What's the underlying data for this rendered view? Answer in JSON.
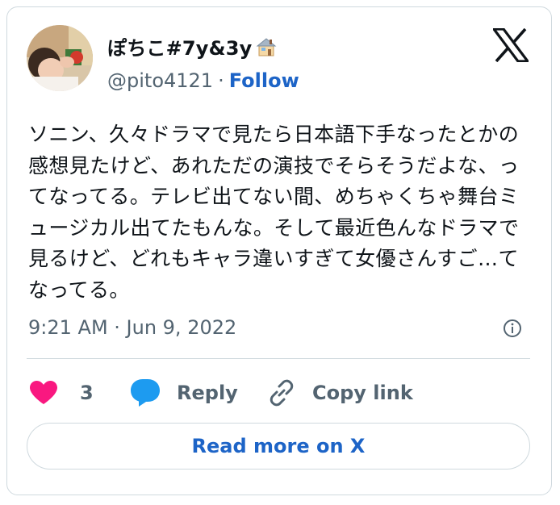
{
  "author": {
    "display_name": "ぽちこ#7y&3y",
    "handle": "@pito4121",
    "separator": "·",
    "follow_label": "Follow",
    "name_emoji_icon": "house-icon"
  },
  "tweet": {
    "text": "ソニン、久々ドラマで見たら日本語下手なったとかの感想見たけど、あれただの演技でそらそうだよな、ってなってる。テレビ出てない間、めちゃくちゃ舞台ミュージカル出てたもんな。そして最近色んなドラマで見るけど、どれもキャラ違いすぎて女優さんすご…てなってる。",
    "timestamp": "9:21 AM · Jun 9, 2022"
  },
  "actions": {
    "like_count": "3",
    "reply_label": "Reply",
    "copy_link_label": "Copy link"
  },
  "read_more_label": "Read more on X",
  "colors": {
    "heart": "#f91880",
    "reply_bubble": "#1d9bf0",
    "link_blue": "#1d64c7",
    "muted_text": "#536471",
    "border": "#cfd9de"
  }
}
